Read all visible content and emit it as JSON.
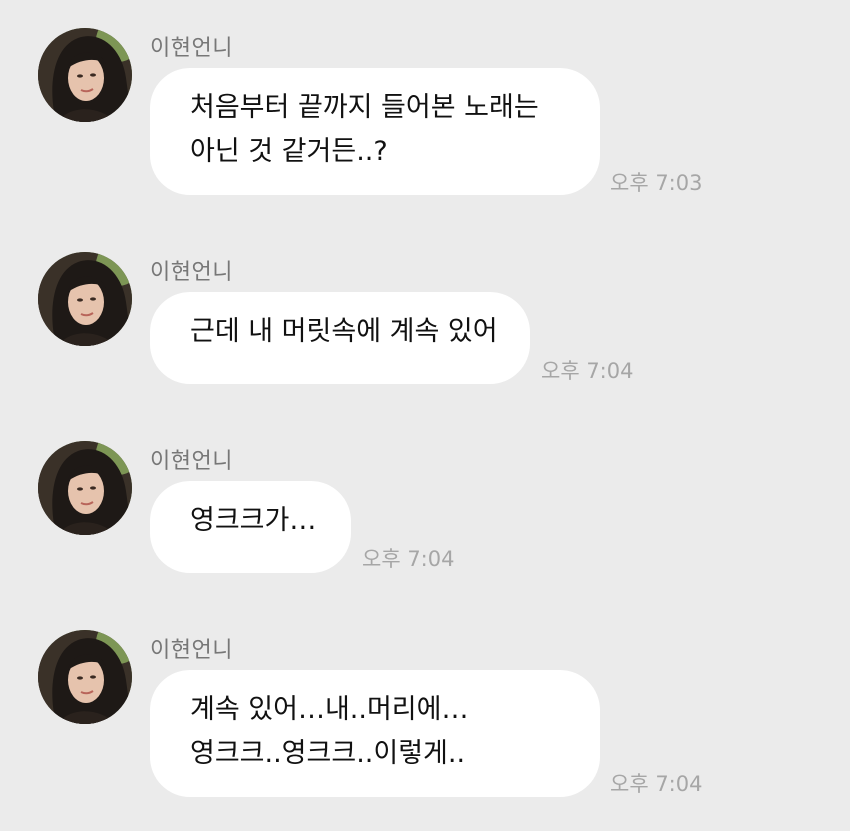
{
  "messages": [
    {
      "sender": "이현언니",
      "lines": [
        "처음부터 끝까지 들어본 노래는",
        "아닌 것 같거든..?"
      ],
      "time": "오후 7:03"
    },
    {
      "sender": "이현언니",
      "lines": [
        "근데 내 머릿속에 계속 있어"
      ],
      "time": "오후 7:04"
    },
    {
      "sender": "이현언니",
      "lines": [
        "영크크가…"
      ],
      "time": "오후 7:04"
    },
    {
      "sender": "이현언니",
      "lines": [
        "계속 있어…내..머리에…",
        "영크크..영크크..이렇게.."
      ],
      "time": "오후 7:04"
    }
  ],
  "colors": {
    "background": "#ebebeb",
    "bubble": "#ffffff",
    "sender_text": "#777777",
    "timestamp_text": "#a6a6a6",
    "message_text": "#111111"
  },
  "icons": {
    "avatar": "profile-photo"
  }
}
